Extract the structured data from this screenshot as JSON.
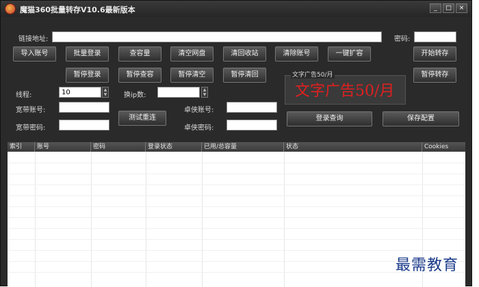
{
  "window": {
    "title": "魔猫360批量转存V10.6最新版本",
    "controls": [
      "_",
      "□",
      "×"
    ]
  },
  "form": {
    "link_label": "链接地址:",
    "link_value": "",
    "password_label": "密码:",
    "password_value": "",
    "threads_label": "线程:",
    "threads_value": "10",
    "ip_label": "换ip数:",
    "ip_value": "",
    "broadband_account_label": "宽带账号:",
    "broadband_account_value": "",
    "broadband_password_label": "宽带密码:",
    "broadband_password_value": "",
    "zhuoyi_account_label": "卓侠账号:",
    "zhuoyi_account_value": "",
    "zhuoyi_password_label": "卓侠密码:",
    "zhuoyi_password_value": ""
  },
  "buttons": {
    "import_accounts": "导入账号",
    "batch_login": "批量登录",
    "check_capacity": "查容量",
    "clear_disk": "清空网盘",
    "clear_recycle": "清回收站",
    "clear_accounts": "清除账号",
    "one_click_expand": "一键扩容",
    "start_transfer": "开始转存",
    "pause_login": "暂停登录",
    "pause_check": "暂停查容",
    "pause_clear": "暂停清空",
    "pause_recycle": "暂停清回",
    "pause_transfer": "暂停转存",
    "test_redial": "测试重连",
    "login_query": "登录查询",
    "save_config": "保存配置"
  },
  "ad": {
    "group_title": "文字广告50/月",
    "text": "文字广告50/月"
  },
  "table": {
    "columns": [
      "索引",
      "账号",
      "密码",
      "登录状态",
      "已用/总容量",
      "状态",
      "Cookies"
    ],
    "rows": []
  },
  "watermark": "最需教育",
  "colors": {
    "window_bg": "#2a2a2a",
    "ad_text": "#e02020",
    "watermark": "#1a3a8a"
  }
}
